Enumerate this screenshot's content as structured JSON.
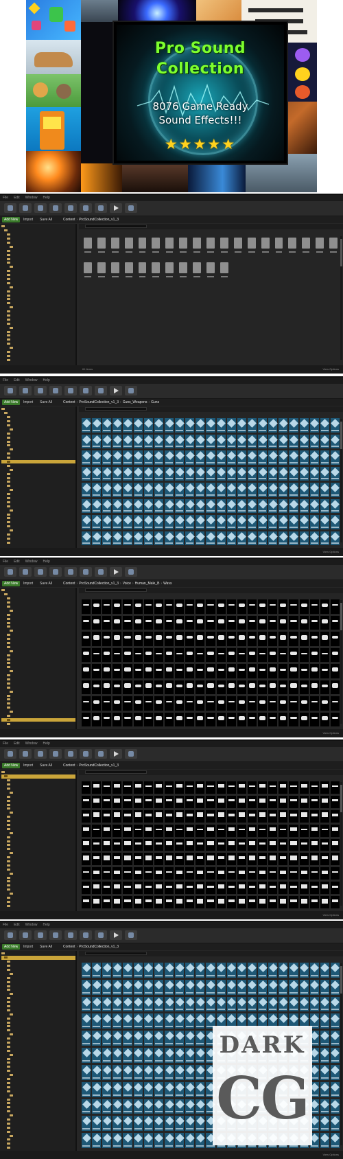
{
  "banner": {
    "title_line1": "Pro Sound",
    "title_line2": "Collection",
    "subtitle_line1": "8076 Game Ready",
    "subtitle_line2": "Sound Effects!!!",
    "stars": "★★★★★",
    "colors": {
      "title": "#7dff2e",
      "stars": "#ffd21e",
      "glow": "#1aa6b8"
    }
  },
  "editor": {
    "menu": [
      "File",
      "Edit",
      "Window",
      "Help"
    ],
    "add_new": "Add New",
    "import": "Import",
    "save_all": "Save All",
    "content_root": "Content",
    "status_right": "View Options"
  },
  "screens": [
    {
      "path": [
        "Content",
        "ProSoundCollection_v1_3"
      ],
      "status": "61 items",
      "grid": "folders"
    },
    {
      "path": [
        "Content",
        "ProSoundCollection_v1_3",
        "Guns_Weapons",
        "Guns"
      ],
      "status": "",
      "grid": "cues"
    },
    {
      "path": [
        "Content",
        "ProSoundCollection_v1_3",
        "Voice",
        "Human_Male_B",
        "Wavs"
      ],
      "status": "",
      "grid": "waves"
    },
    {
      "path": [
        "Content",
        "ProSoundCollection_v1_3"
      ],
      "status": "",
      "grid": "waves_boxy"
    },
    {
      "path": [
        "Content",
        "ProSoundCollection_v1_3"
      ],
      "status": "",
      "grid": "cues"
    }
  ],
  "watermark": {
    "top": "DARK",
    "bottom": "CG"
  }
}
